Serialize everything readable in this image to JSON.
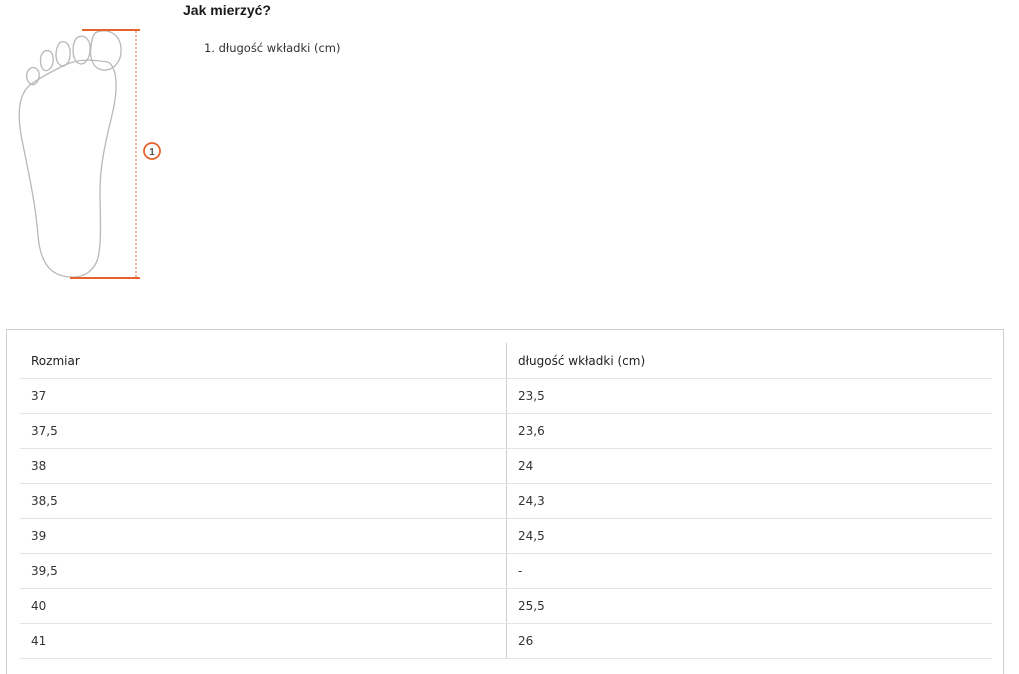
{
  "guide": {
    "title": "Jak mierzyć?",
    "marker_number": "1",
    "steps": [
      "1. długość wkładki (cm)"
    ]
  },
  "colors": {
    "accent": "#e8632b",
    "outline": "#b8b8b8"
  },
  "table": {
    "headers": [
      "Rozmiar",
      "długość wkładki (cm)"
    ],
    "rows": [
      [
        "37",
        "23,5"
      ],
      [
        "37,5",
        "23,6"
      ],
      [
        "38",
        "24"
      ],
      [
        "38,5",
        "24,3"
      ],
      [
        "39",
        "24,5"
      ],
      [
        "39,5",
        "-"
      ],
      [
        "40",
        "25,5"
      ],
      [
        "41",
        "26"
      ]
    ]
  }
}
